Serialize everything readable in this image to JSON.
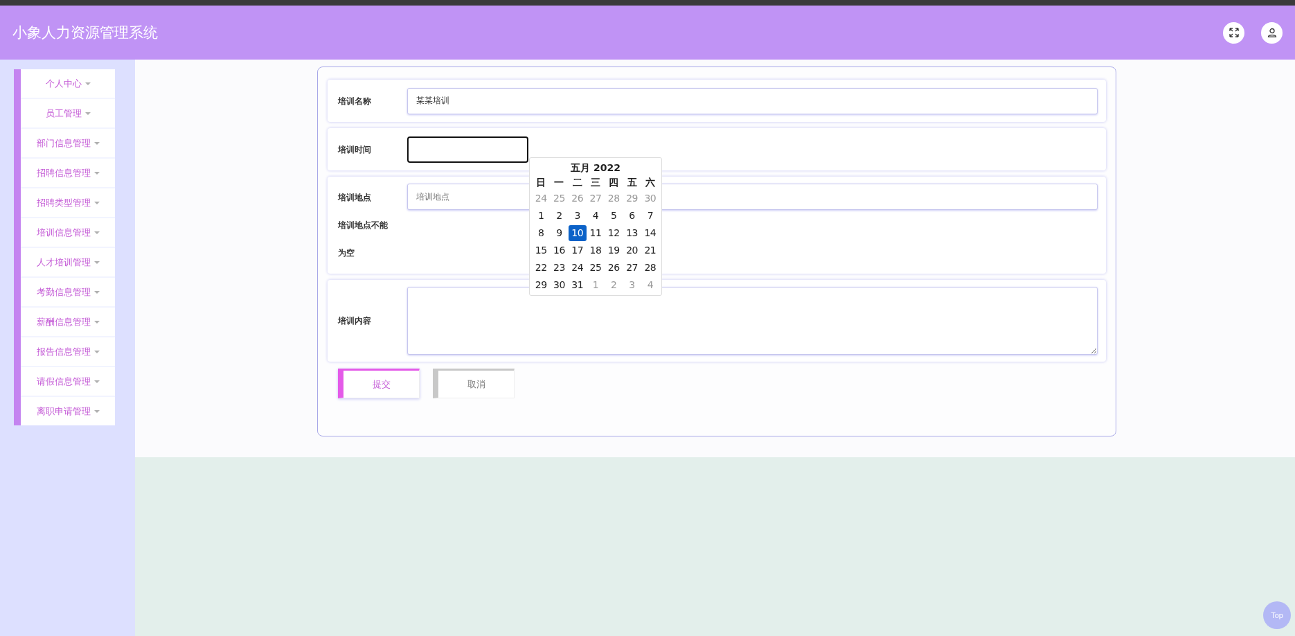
{
  "header": {
    "title": "小象人力资源管理系统"
  },
  "sidebar": {
    "items": [
      {
        "label": "个人中心"
      },
      {
        "label": "员工管理"
      },
      {
        "label": "部门信息管理"
      },
      {
        "label": "招聘信息管理"
      },
      {
        "label": "招聘类型管理"
      },
      {
        "label": "培训信息管理"
      },
      {
        "label": "人才培训管理"
      },
      {
        "label": "考勤信息管理"
      },
      {
        "label": "薪酬信息管理"
      },
      {
        "label": "报告信息管理"
      },
      {
        "label": "请假信息管理"
      },
      {
        "label": "离职申请管理"
      }
    ]
  },
  "form": {
    "fields": [
      {
        "kind": "text",
        "label": "培训名称",
        "value": "某某培训"
      },
      {
        "kind": "date",
        "label": "培训时间",
        "focused": true
      },
      {
        "kind": "text",
        "label": "培训地点",
        "placeholder": "培训地点",
        "error": "培训地点不能为空"
      },
      {
        "kind": "textarea",
        "label": "培训内容"
      }
    ],
    "buttons": [
      {
        "kind": "primary",
        "label": "提交"
      },
      {
        "kind": "secondary",
        "label": "取消"
      }
    ]
  },
  "calendar": {
    "title": "五月 2022",
    "weekdays": [
      "日",
      "一",
      "二",
      "三",
      "四",
      "五",
      "六"
    ],
    "days": [
      {
        "text": "24",
        "muted": true,
        "selected": false
      },
      {
        "text": "25",
        "muted": true,
        "selected": false
      },
      {
        "text": "26",
        "muted": true,
        "selected": false
      },
      {
        "text": "27",
        "muted": true,
        "selected": false
      },
      {
        "text": "28",
        "muted": true,
        "selected": false
      },
      {
        "text": "29",
        "muted": true,
        "selected": false
      },
      {
        "text": "30",
        "muted": true,
        "selected": false
      },
      {
        "text": "1",
        "muted": false,
        "selected": false
      },
      {
        "text": "2",
        "muted": false,
        "selected": false
      },
      {
        "text": "3",
        "muted": false,
        "selected": false
      },
      {
        "text": "4",
        "muted": false,
        "selected": false
      },
      {
        "text": "5",
        "muted": false,
        "selected": false
      },
      {
        "text": "6",
        "muted": false,
        "selected": false
      },
      {
        "text": "7",
        "muted": false,
        "selected": false
      },
      {
        "text": "8",
        "muted": false,
        "selected": false
      },
      {
        "text": "9",
        "muted": false,
        "selected": false
      },
      {
        "text": "10",
        "muted": false,
        "selected": true
      },
      {
        "text": "11",
        "muted": false,
        "selected": false
      },
      {
        "text": "12",
        "muted": false,
        "selected": false
      },
      {
        "text": "13",
        "muted": false,
        "selected": false
      },
      {
        "text": "14",
        "muted": false,
        "selected": false
      },
      {
        "text": "15",
        "muted": false,
        "selected": false
      },
      {
        "text": "16",
        "muted": false,
        "selected": false
      },
      {
        "text": "17",
        "muted": false,
        "selected": false
      },
      {
        "text": "18",
        "muted": false,
        "selected": false
      },
      {
        "text": "19",
        "muted": false,
        "selected": false
      },
      {
        "text": "20",
        "muted": false,
        "selected": false
      },
      {
        "text": "21",
        "muted": false,
        "selected": false
      },
      {
        "text": "22",
        "muted": false,
        "selected": false
      },
      {
        "text": "23",
        "muted": false,
        "selected": false
      },
      {
        "text": "24",
        "muted": false,
        "selected": false
      },
      {
        "text": "25",
        "muted": false,
        "selected": false
      },
      {
        "text": "26",
        "muted": false,
        "selected": false
      },
      {
        "text": "27",
        "muted": false,
        "selected": false
      },
      {
        "text": "28",
        "muted": false,
        "selected": false
      },
      {
        "text": "29",
        "muted": false,
        "selected": false
      },
      {
        "text": "30",
        "muted": false,
        "selected": false
      },
      {
        "text": "31",
        "muted": false,
        "selected": false
      },
      {
        "text": "1",
        "muted": true,
        "selected": false
      },
      {
        "text": "2",
        "muted": true,
        "selected": false
      },
      {
        "text": "3",
        "muted": true,
        "selected": false
      },
      {
        "text": "4",
        "muted": true,
        "selected": false
      }
    ]
  },
  "back_to_top": {
    "label": "Top"
  }
}
